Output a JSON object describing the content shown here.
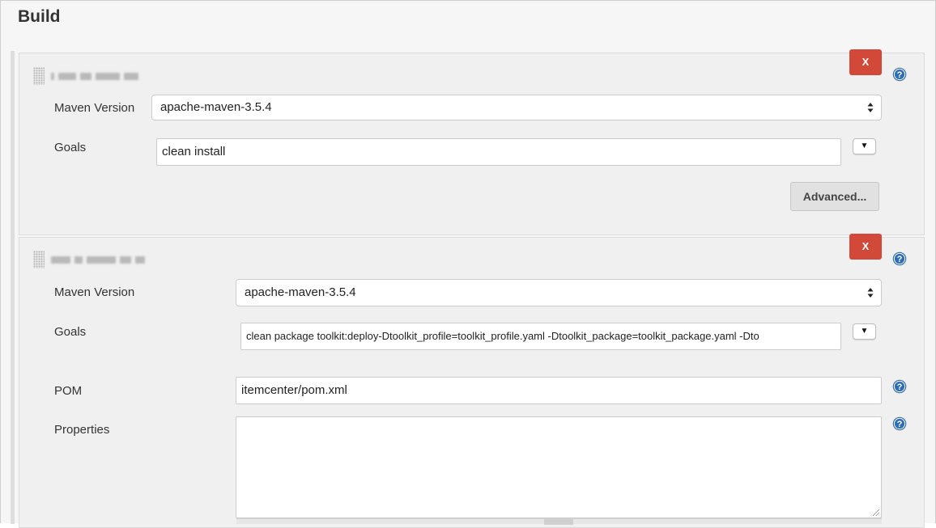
{
  "section": {
    "title": "Build"
  },
  "steps": [
    {
      "maven_version_label": "Maven Version",
      "maven_version_value": "apache-maven-3.5.4",
      "goals_label": "Goals",
      "goals_value": "clean install",
      "advanced_label": "Advanced...",
      "delete_label": "X"
    },
    {
      "maven_version_label": "Maven Version",
      "maven_version_value": "apache-maven-3.5.4",
      "goals_label": "Goals",
      "goals_value": "clean package toolkit:deploy-Dtoolkit_profile=toolkit_profile.yaml -Dtoolkit_package=toolkit_package.yaml -Dto",
      "pom_label": "POM",
      "pom_value": "itemcenter/pom.xml",
      "properties_label": "Properties",
      "properties_value": "",
      "delete_label": "X"
    }
  ],
  "icons": {
    "help": "help-icon",
    "drag": "drag-handle-icon",
    "select_arrows": "select-arrows-icon",
    "dropdown": "dropdown-arrow-icon"
  },
  "colors": {
    "delete": "#d24939",
    "help": "#2f6db5",
    "panel": "#f0f0f0"
  }
}
